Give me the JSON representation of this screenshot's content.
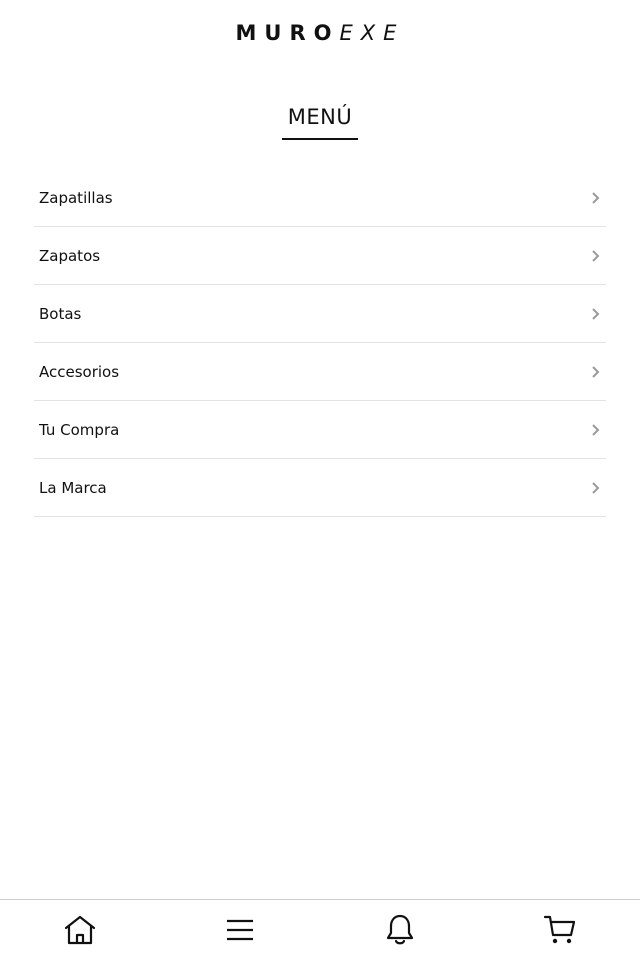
{
  "header": {
    "brand_bold": "MURO",
    "brand_italic": "EXE"
  },
  "menu": {
    "title": "MENÚ",
    "items": [
      {
        "label": "Zapatillas"
      },
      {
        "label": "Zapatos"
      },
      {
        "label": "Botas"
      },
      {
        "label": "Accesorios"
      },
      {
        "label": "Tu Compra"
      },
      {
        "label": "La Marca"
      }
    ]
  },
  "bottom_nav": {
    "items": [
      {
        "icon": "home-icon"
      },
      {
        "icon": "hamburger-menu-icon"
      },
      {
        "icon": "bell-icon"
      },
      {
        "icon": "shopping-cart-icon"
      }
    ]
  },
  "colors": {
    "text": "#111111",
    "divider": "#e2e2e2",
    "chevron": "#9a9a9a",
    "background": "#ffffff"
  }
}
